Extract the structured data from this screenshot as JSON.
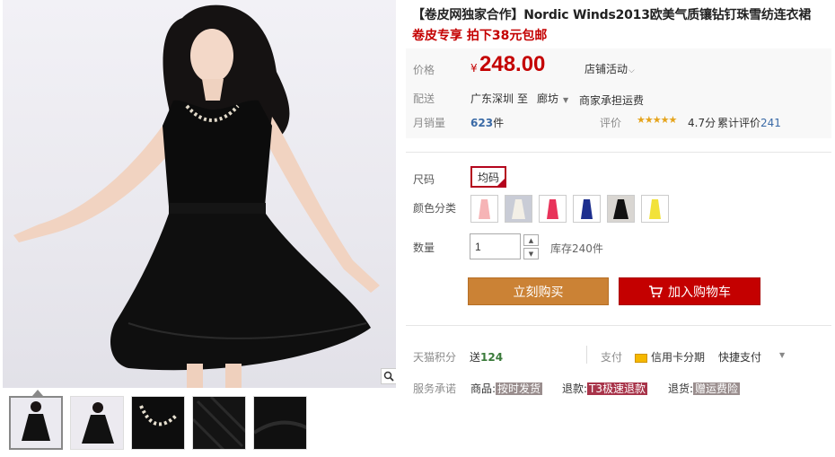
{
  "product": {
    "title": "【卷皮网独家合作】Nordic Winds2013欧美气质镶钻钉珠雪纺连衣裙",
    "subtitle": "卷皮专享 拍下38元包邮"
  },
  "price": {
    "label": "价格",
    "currency": "¥",
    "value": "248.00",
    "promo_label": "店铺活动"
  },
  "shipping": {
    "label": "配送",
    "from": "广东深圳",
    "to_word": "至",
    "to": "廊坊",
    "fee": "商家承担运费"
  },
  "sales": {
    "label": "月销量",
    "count": "623",
    "unit": "件",
    "rating_label": "评价",
    "stars": "★★★★★",
    "score": "4.7分",
    "review_label": "累计评价",
    "review_count": "241"
  },
  "size": {
    "label": "尺码",
    "option": "均码"
  },
  "color": {
    "label": "颜色分类",
    "swatches": [
      "pink-dress",
      "white-dress",
      "red-dress",
      "blue-dress",
      "black-dress",
      "yellow-dress"
    ]
  },
  "quantity": {
    "label": "数量",
    "value": "1",
    "stock": "库存240件"
  },
  "actions": {
    "buy_now": "立刻购买",
    "add_to_cart": "加入购物车"
  },
  "points": {
    "label": "天猫积分",
    "give": "送",
    "value": "124",
    "pay_label": "支付",
    "installment": "信用卡分期",
    "quick_pay": "快捷支付"
  },
  "service": {
    "label": "服务承诺",
    "goods_label": "商品:",
    "goods_tag": "按时发货",
    "refund_label": "退款:",
    "refund_tag": "T3极速退款",
    "return_label": "退货:",
    "return_tag": "赠运费险"
  },
  "colors": {
    "price_red": "#c40000",
    "buy_orange": "#cb8235",
    "cart_red": "#c40000",
    "link_blue": "#3a6aa6",
    "star_gold": "#e5a41c"
  }
}
